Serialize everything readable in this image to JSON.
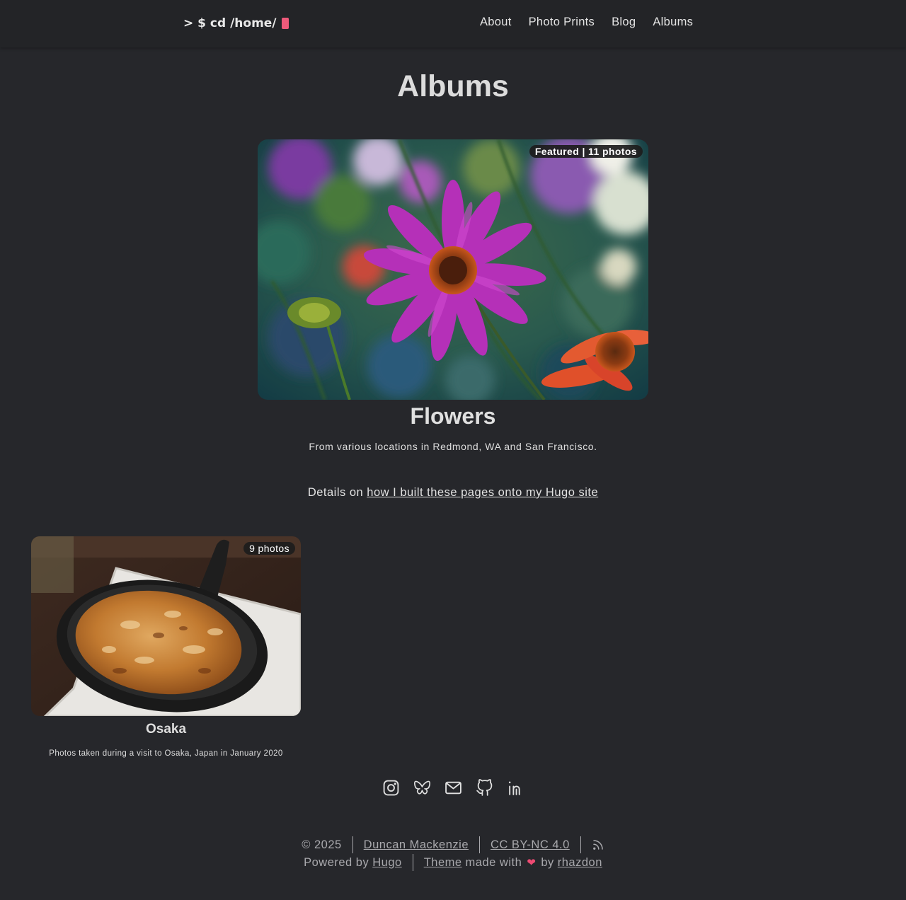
{
  "header": {
    "logo_text": "> $ cd /home/",
    "nav": [
      "About",
      "Photo Prints",
      "Blog",
      "Albums"
    ]
  },
  "page": {
    "title": "Albums"
  },
  "featured_album": {
    "badge": "Featured | 11 photos",
    "title": "Flowers",
    "description": "From various locations in Redmond, WA and San Francisco."
  },
  "details": {
    "prefix": "Details on",
    "link_text": "how I built these pages onto my Hugo site"
  },
  "albums": [
    {
      "badge": "9 photos",
      "title": "Osaka",
      "description": "Photos taken during a visit to Osaka, Japan in January 2020"
    }
  ],
  "social_icons": [
    "instagram-icon",
    "bluesky-butterfly-icon",
    "mail-icon",
    "github-icon",
    "linkedin-icon"
  ],
  "footer": {
    "copyright": "© 2025",
    "author": "Duncan Mackenzie",
    "license": "CC BY-NC 4.0",
    "powered_by": "Powered by",
    "hugo": "Hugo",
    "theme": "Theme",
    "made_with": "made with",
    "by": "by",
    "theme_author": "rhazdon"
  },
  "colors": {
    "background": "#26272b",
    "header_background": "#232427",
    "cursor_accent": "#ee5a7a",
    "heart": "#ee4a72"
  }
}
